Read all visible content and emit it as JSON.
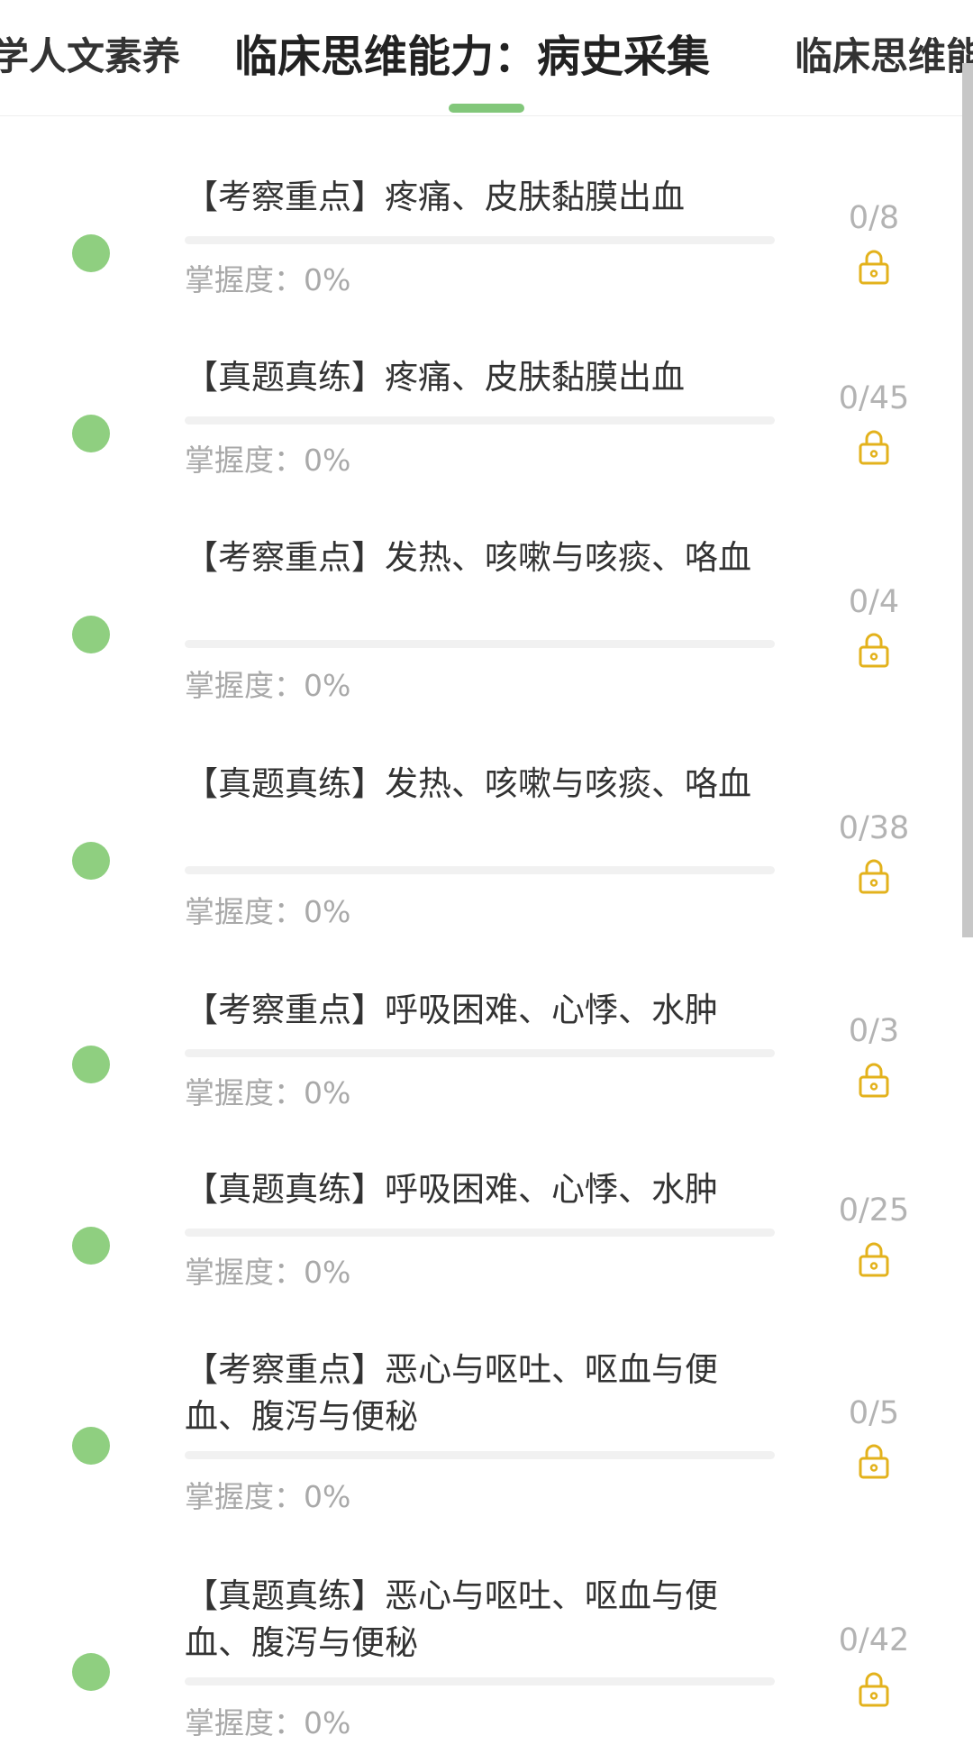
{
  "tabs": [
    {
      "label": "学人文素养"
    },
    {
      "label": "临床思维能力：病史采集"
    },
    {
      "label": "临床思维能"
    }
  ],
  "colors": {
    "accent": "#82c77a",
    "dot": "#8fcf80",
    "lock": "#e3b21c"
  },
  "mastery_prefix": "掌握度：",
  "items": [
    {
      "title": "【考察重点】疼痛、皮肤黏膜出血",
      "mastery": "0%",
      "mastery_fraction": 0,
      "count": "0/8",
      "locked": true,
      "icon": "lock-icon"
    },
    {
      "title": "【真题真练】疼痛、皮肤黏膜出血",
      "mastery": "0%",
      "mastery_fraction": 0,
      "count": "0/45",
      "locked": true,
      "icon": "lock-icon"
    },
    {
      "title": "【考察重点】发热、咳嗽与咳痰、咯血",
      "mastery": "0%",
      "mastery_fraction": 0,
      "count": "0/4",
      "locked": true,
      "icon": "lock-icon"
    },
    {
      "title": "【真题真练】发热、咳嗽与咳痰、咯血",
      "mastery": "0%",
      "mastery_fraction": 0,
      "count": "0/38",
      "locked": true,
      "icon": "lock-icon"
    },
    {
      "title": "【考察重点】呼吸困难、心悸、水肿",
      "mastery": "0%",
      "mastery_fraction": 0,
      "count": "0/3",
      "locked": true,
      "icon": "lock-icon"
    },
    {
      "title": "【真题真练】呼吸困难、心悸、水肿",
      "mastery": "0%",
      "mastery_fraction": 0,
      "count": "0/25",
      "locked": true,
      "icon": "lock-icon"
    },
    {
      "title": "【考察重点】恶心与呕吐、呕血与便血、腹泻与便秘",
      "mastery": "0%",
      "mastery_fraction": 0,
      "count": "0/5",
      "locked": true,
      "icon": "lock-icon"
    },
    {
      "title": "【真题真练】恶心与呕吐、呕血与便血、腹泻与便秘",
      "mastery": "0%",
      "mastery_fraction": 0,
      "count": "0/42",
      "locked": true,
      "icon": "lock-icon"
    }
  ]
}
